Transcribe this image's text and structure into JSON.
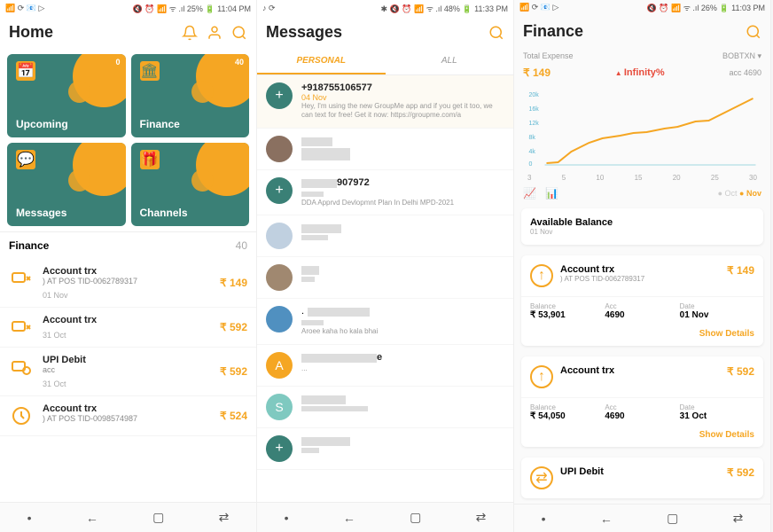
{
  "screen1": {
    "status": {
      "left": "📶 ⟳ 📧 ▷",
      "right": "🔇 ⏰ 📶 ᯤ .ıl 25% 🔋 11:04 PM"
    },
    "title": "Home",
    "cards": [
      {
        "label": "Upcoming",
        "badge": "0",
        "icon": "calendar"
      },
      {
        "label": "Finance",
        "badge": "40",
        "icon": "bank"
      },
      {
        "label": "Messages",
        "badge": "",
        "icon": "chat"
      },
      {
        "label": "Channels",
        "badge": "",
        "icon": "gift"
      }
    ],
    "section": {
      "title": "Finance",
      "count": "40"
    },
    "trx": [
      {
        "title": "Account trx",
        "sub": ") AT POS TID-0062789317",
        "date": "01 Nov",
        "amt": "₹ 149"
      },
      {
        "title": "Account trx",
        "sub": "",
        "date": "31 Oct",
        "amt": "₹ 592"
      },
      {
        "title": "UPI Debit",
        "sub": "acc",
        "date": "31 Oct",
        "amt": "₹ 592"
      },
      {
        "title": "Account trx",
        "sub": ") AT POS TID-0098574987",
        "date": "",
        "amt": "₹ 524"
      }
    ]
  },
  "screen2": {
    "status": {
      "left": "♪ ⟳",
      "right": "✱ 🔇 ⏰ 📶 ᯤ .ıl 48% 🔋 11:33 PM"
    },
    "title": "Messages",
    "tabs": {
      "personal": "PERSONAL",
      "all": "ALL"
    },
    "msgs": [
      {
        "type": "add",
        "title": "+918755106577",
        "date": "04 Nov",
        "body": "Hey, I'm using the new GroupMe app and if you get it too, we can text for free! Get it now: https://groupme.com/a"
      },
      {
        "type": "photo",
        "title": "",
        "body": ""
      },
      {
        "type": "add",
        "title_suffix": "907972",
        "body": "DDA Apprvd Devlopmnt Plan In Delhi MPD-2021"
      },
      {
        "type": "photo",
        "title": "",
        "body": ""
      },
      {
        "type": "photo",
        "title": "",
        "body": ""
      },
      {
        "type": "photo",
        "title": "",
        "body": "Aroee kaha ho kala bhai"
      },
      {
        "type": "orange",
        "letter": "A",
        "title_suffix": "e",
        "body": "..."
      },
      {
        "type": "teal",
        "letter": "S",
        "title": "",
        "body": ""
      },
      {
        "type": "add",
        "title": "",
        "body": ""
      }
    ]
  },
  "screen3": {
    "status": {
      "left": "📶 ⟳ 📧 ▷",
      "right": "🔇 ⏰ 📶 ᯤ .ıl 26% 🔋 11:03 PM"
    },
    "title": "Finance",
    "dropdown": "BOBTXN ▾",
    "total": {
      "label": "Total Expense",
      "amt": "₹ 149",
      "infinity": "Infinity%",
      "acc": "acc 4690"
    },
    "chart_data": {
      "type": "line",
      "x": [
        3,
        5,
        10,
        15,
        20,
        25,
        30
      ],
      "ylabels": [
        "20k",
        "16k",
        "12k",
        "8k",
        "4k",
        "0"
      ],
      "ylim": [
        0,
        20000
      ],
      "series": [
        {
          "name": "Nov",
          "values": [
            500,
            800,
            3500,
            7500,
            8800,
            10200,
            10800,
            11000,
            12000,
            12500,
            14000,
            14200,
            16500,
            19800
          ]
        }
      ],
      "legend": {
        "oct": "Oct",
        "nov": "Nov"
      }
    },
    "balance": {
      "title": "Available Balance",
      "date": "01 Nov"
    },
    "trx": [
      {
        "title": "Account trx",
        "sub": ") AT POS TID-0062789317",
        "amt": "₹ 149",
        "balance": "₹ 53,901",
        "acc": "4690",
        "date": "01 Nov",
        "show": "Show Details"
      },
      {
        "title": "Account trx",
        "sub": "",
        "amt": "₹ 592",
        "balance": "₹ 54,050",
        "acc": "4690",
        "date": "31 Oct",
        "show": "Show Details"
      },
      {
        "title": "UPI Debit",
        "sub": "",
        "amt": "₹ 592"
      }
    ],
    "labels": {
      "balance": "Balance",
      "acc": "Acc",
      "date": "Date"
    }
  }
}
